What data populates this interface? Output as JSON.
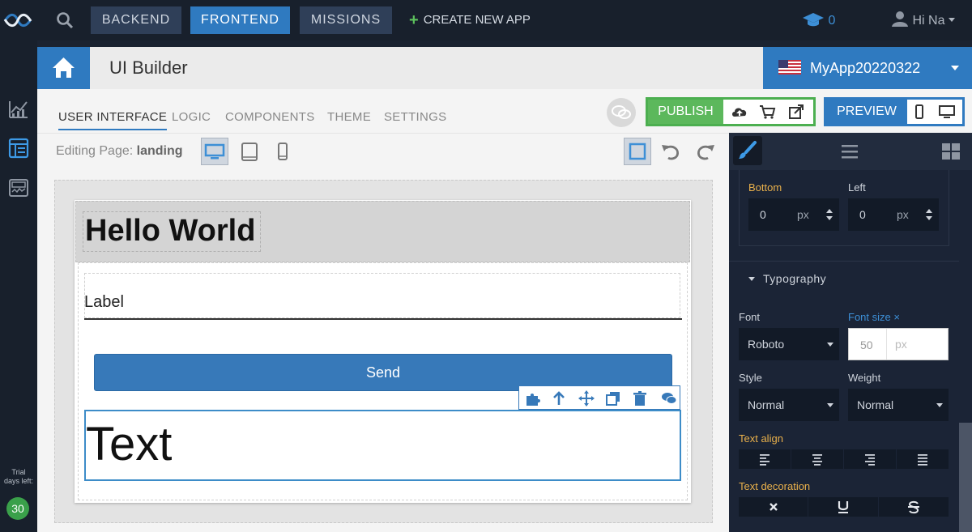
{
  "topnav": {
    "backend_label": "BACKEND",
    "frontend_label": "FRONTEND",
    "missions_label": "MISSIONS",
    "create_app_label": "CREATE NEW APP",
    "grad_count": "0",
    "user_greeting": "Hi Na"
  },
  "trial": {
    "label_line1": "Trial",
    "label_line2": "days left:",
    "days": "30"
  },
  "header": {
    "title": "UI Builder",
    "app_name": "MyApp20220322"
  },
  "tabs": [
    "USER INTERFACE",
    "LOGIC",
    "COMPONENTS",
    "THEME",
    "SETTINGS"
  ],
  "actions": {
    "publish_label": "PUBLISH",
    "preview_label": "PREVIEW"
  },
  "editor": {
    "editing_prefix": "Editing Page:",
    "page_name": "landing"
  },
  "canvas": {
    "heading": "Hello World",
    "input_label": "Label",
    "button_label": "Send",
    "text_block": "Text"
  },
  "panel": {
    "bottom_label": "Bottom",
    "left_label": "Left",
    "bottom_value": "0",
    "left_value": "0",
    "unit": "px",
    "typography_label": "Typography",
    "font_label": "Font",
    "font_value": "Roboto",
    "font_size_label": "Font size",
    "font_size_clear": "×",
    "font_size_value": "50",
    "font_size_unit": "px",
    "style_label": "Style",
    "style_value": "Normal",
    "weight_label": "Weight",
    "weight_value": "Normal",
    "text_align_label": "Text align",
    "text_decoration_label": "Text decoration"
  },
  "colors": {
    "accent": "#2f7ac0",
    "publish": "#5cb85c",
    "panel_bg": "#1b2436",
    "label_orange": "#e9b04b"
  }
}
